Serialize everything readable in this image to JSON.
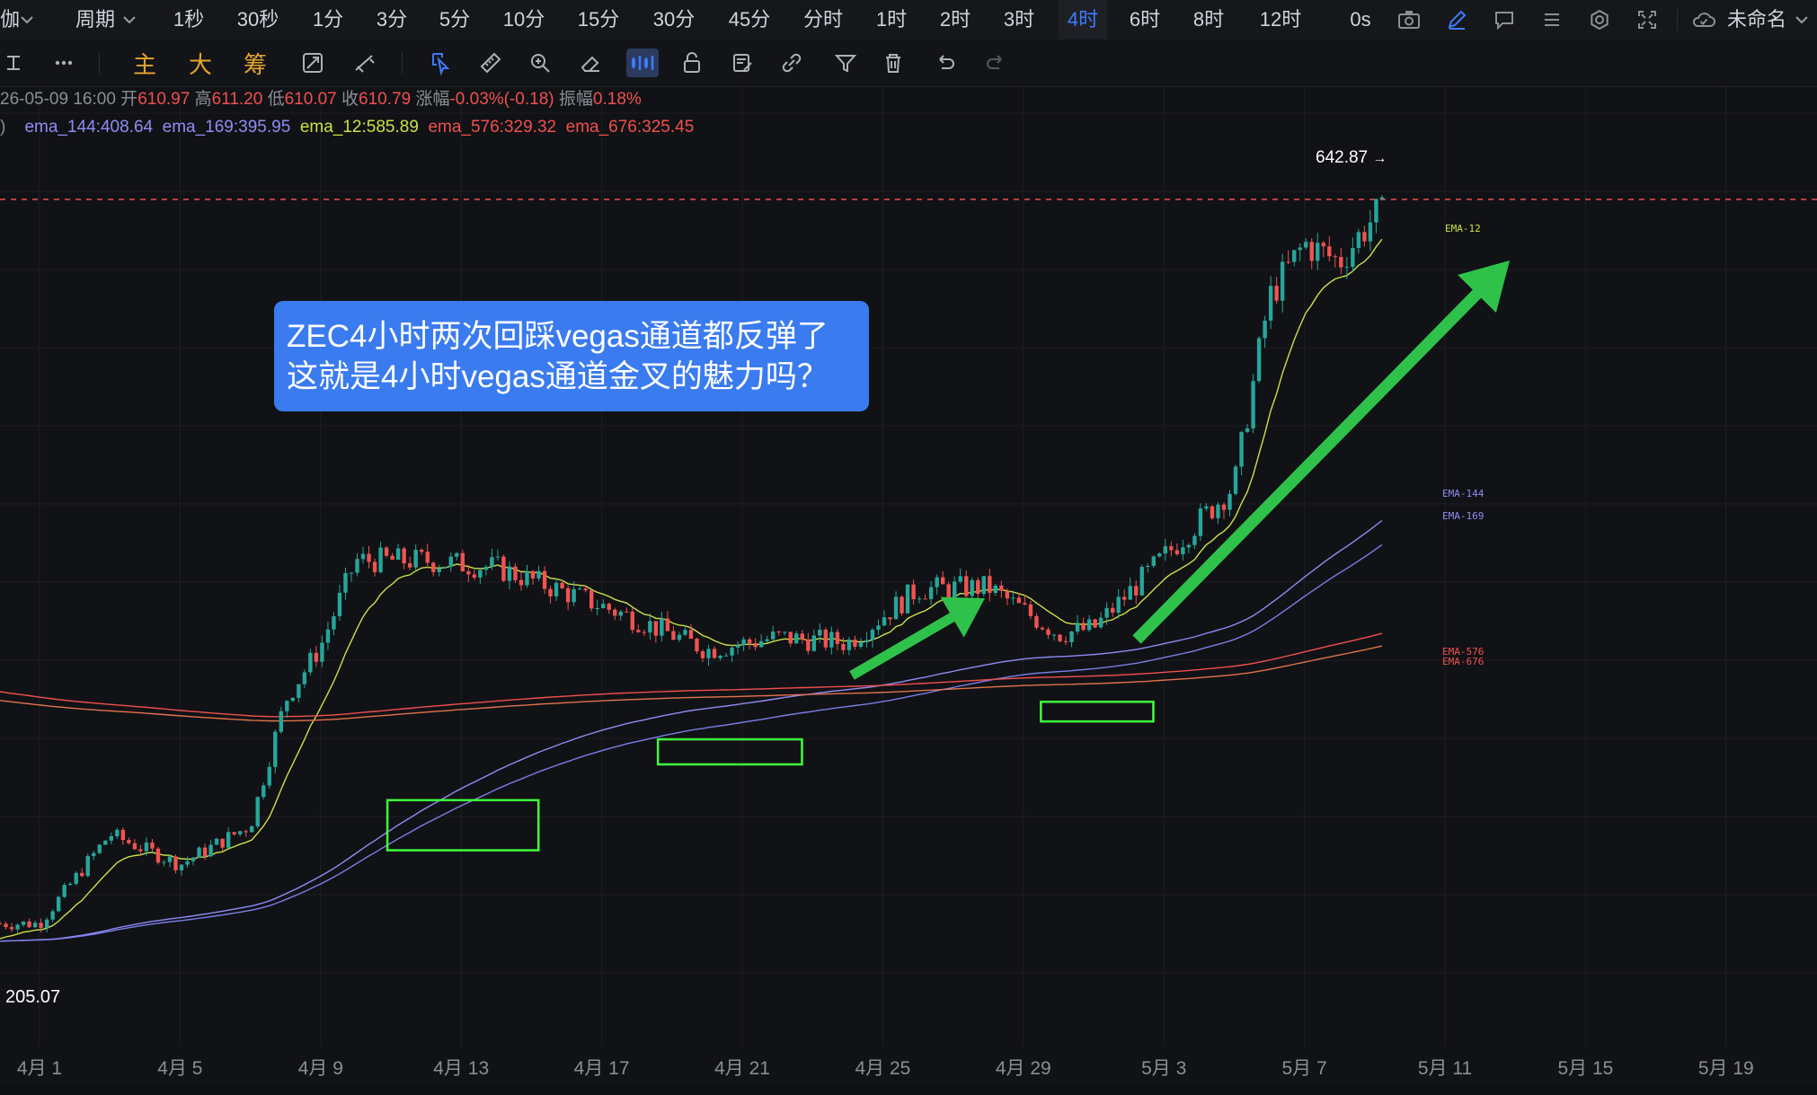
{
  "topbar": {
    "symbol_fragment": "伽",
    "period_label": "周期",
    "intervals": [
      "1秒",
      "30秒",
      "1分",
      "3分",
      "5分",
      "10分",
      "15分",
      "30分",
      "45分",
      "分时",
      "1时",
      "2时",
      "3时",
      "4时",
      "6时",
      "8时",
      "12时"
    ],
    "active_interval": "4时",
    "countdown": "0s",
    "layout_name": "未命名"
  },
  "toolbar": {
    "indicator_main": "主",
    "indicator_big": "大",
    "indicator_chip": "筹"
  },
  "ohlc": {
    "datetime": "26-05-09 16:00",
    "open_label": "开",
    "open": "610.97",
    "high_label": "高",
    "high": "611.20",
    "low_label": "低",
    "low": "610.07",
    "close_label": "收",
    "close": "610.79",
    "change_label": "涨幅",
    "change": "-0.03%(-0.18)",
    "amplitude_label": "振幅",
    "amplitude": "0.18%"
  },
  "emas": {
    "prefix": ")",
    "ema_144": "ema_144:408.64",
    "ema_169": "ema_169:395.95",
    "ema_12": "ema_12:585.89",
    "ema_576": "ema_576:329.32",
    "ema_676": "ema_676:325.45"
  },
  "labels": {
    "high_price": "642.87",
    "low_price": "205.07",
    "ema12_tag": "EMA-12",
    "ema144_tag": "EMA-144",
    "ema169_tag": "EMA-169",
    "ema576_tag": "EMA-576",
    "ema676_tag": "EMA-676"
  },
  "callout": {
    "line1": "ZEC4小时两次回踩vegas通道都反弹了",
    "line2": "这就是4小时vegas通道金叉的魅力吗？"
  },
  "colors": {
    "up": "#26a69a",
    "down": "#ef5350",
    "ema12": "#cbe048",
    "ema144": "#8f8cf5",
    "ema169": "#7b7ee8",
    "ema576": "#f0504f",
    "ema676": "#e0734c",
    "box": "#3dff3d",
    "arrow": "#2fc24a",
    "callout_bg": "#3a7bf0"
  },
  "chart_data": {
    "type": "candlestick",
    "interval": "4时",
    "x_tick_labels": [
      "4月 1",
      "4月 5",
      "4月 9",
      "4月 13",
      "4月 17",
      "4月 21",
      "4月 25",
      "4月 29",
      "5月 3",
      "5月 7",
      "5月 11",
      "5月 15",
      "5月 19"
    ],
    "y_visible_high": 642.87,
    "y_visible_low": 205.07,
    "last_close": 610.79,
    "trend_closes": [
      {
        "date": "4月 1",
        "close": 215
      },
      {
        "date": "4月 3",
        "close": 265
      },
      {
        "date": "4月 5",
        "close": 248
      },
      {
        "date": "4月 7",
        "close": 270
      },
      {
        "date": "4月 8",
        "close": 340
      },
      {
        "date": "4月 9",
        "close": 370
      },
      {
        "date": "4月 10",
        "close": 418
      },
      {
        "date": "4月 12",
        "close": 418
      },
      {
        "date": "4月 14",
        "close": 414
      },
      {
        "date": "4月 16",
        "close": 400
      },
      {
        "date": "4月 18",
        "close": 385
      },
      {
        "date": "4月 20",
        "close": 368
      },
      {
        "date": "4月 22",
        "close": 375
      },
      {
        "date": "4月 24",
        "close": 372
      },
      {
        "date": "4月 26",
        "close": 402
      },
      {
        "date": "4月 28",
        "close": 403
      },
      {
        "date": "4月 30",
        "close": 377
      },
      {
        "date": "5月 1",
        "close": 380
      },
      {
        "date": "5月 3",
        "close": 420
      },
      {
        "date": "5月 5",
        "close": 460
      },
      {
        "date": "5月 6",
        "close": 565
      },
      {
        "date": "5月 7",
        "close": 595
      },
      {
        "date": "5月 8",
        "close": 585
      },
      {
        "date": "5月 9",
        "close": 610.79
      }
    ],
    "ema_series": [
      {
        "name": "EMA-12",
        "last": 585.89
      },
      {
        "name": "EMA-144",
        "last": 408.64
      },
      {
        "name": "EMA-169",
        "last": 395.95
      },
      {
        "name": "EMA-576",
        "last": 329.32
      },
      {
        "name": "EMA-676",
        "last": 325.45
      }
    ]
  }
}
